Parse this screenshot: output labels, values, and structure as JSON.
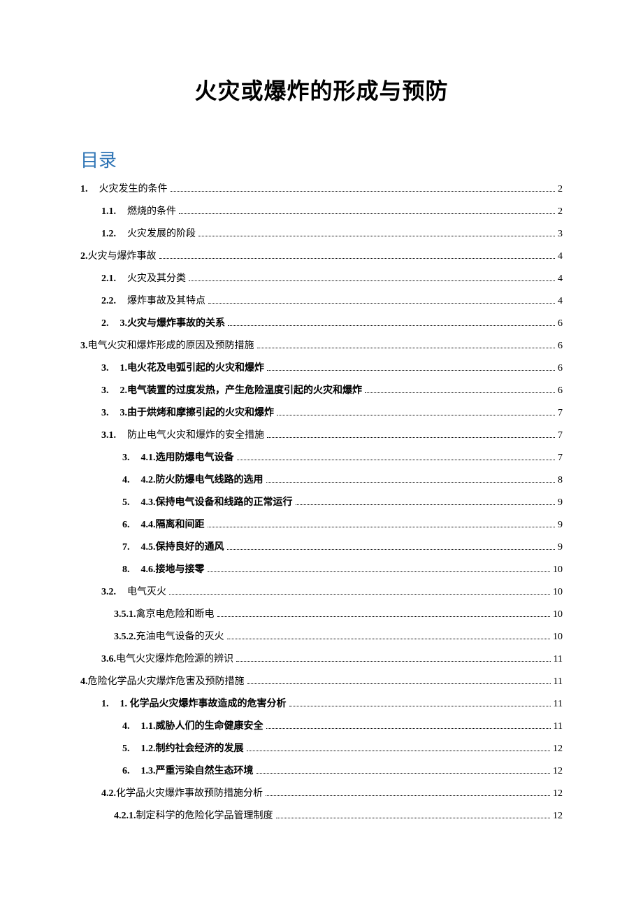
{
  "title": "火灾或爆炸的形成与预防",
  "toc_header": "目录",
  "toc": [
    {
      "indent": "ind-0",
      "num": "1.",
      "numBold": true,
      "text": "火灾发生的条件",
      "textBold": false,
      "page": "2"
    },
    {
      "indent": "ind-1",
      "num": "1.1.",
      "numBold": true,
      "text": "燃烧的条件",
      "textBold": false,
      "page": "2"
    },
    {
      "indent": "ind-1",
      "num": "1.2.",
      "numBold": true,
      "text": "火灾发展的阶段",
      "textBold": false,
      "page": "3"
    },
    {
      "indent": "ind-0",
      "num": "2.",
      "numBold": true,
      "text": "火灾与爆炸事故",
      "textBold": false,
      "page": "4",
      "joined": true
    },
    {
      "indent": "ind-1",
      "num": "2.1.",
      "numBold": true,
      "text": "火灾及其分类",
      "textBold": false,
      "page": "4"
    },
    {
      "indent": "ind-1",
      "num": "2.2.",
      "numBold": true,
      "text": "爆炸事故及其特点",
      "textBold": false,
      "page": "4"
    },
    {
      "indent": "ind-1",
      "num": "2.",
      "numBold": true,
      "text": "3.火灾与爆炸事故的关系",
      "textBold": true,
      "page": "6"
    },
    {
      "indent": "ind-0",
      "num": "3.",
      "numBold": true,
      "text": "电气火灾和爆炸形成的原因及预防措施",
      "textBold": false,
      "page": "6",
      "joined": true
    },
    {
      "indent": "ind-1",
      "num": "3.",
      "numBold": true,
      "text": "1.电火花及电弧引起的火灾和爆炸",
      "textBold": true,
      "page": "6"
    },
    {
      "indent": "ind-1",
      "num": "3.",
      "numBold": true,
      "text": "2.电气装置的过度发热，产生危险温度引起的火灾和爆炸",
      "textBold": true,
      "page": "6"
    },
    {
      "indent": "ind-1",
      "num": "3.",
      "numBold": true,
      "text": "3.由于烘烤和摩擦引起的火灾和爆炸",
      "textBold": true,
      "page": "7"
    },
    {
      "indent": "ind-1",
      "num": "3.1.",
      "numBold": true,
      "text": "防止电气火灾和爆炸的安全措施",
      "textBold": false,
      "page": "7"
    },
    {
      "indent": "ind-2",
      "num": "3.",
      "numBold": true,
      "text": "4.1.选用防爆电气设备",
      "textBold": true,
      "page": "7"
    },
    {
      "indent": "ind-2",
      "num": "4.",
      "numBold": true,
      "text": "4.2.防火防爆电气线路的选用",
      "textBold": true,
      "page": "8"
    },
    {
      "indent": "ind-2",
      "num": "5.",
      "numBold": true,
      "text": "4.3.保持电气设备和线路的正常运行",
      "textBold": true,
      "page": "9"
    },
    {
      "indent": "ind-2",
      "num": "6.",
      "numBold": true,
      "text": "4.4.隔离和间距",
      "textBold": true,
      "page": "9"
    },
    {
      "indent": "ind-2",
      "num": "7.",
      "numBold": true,
      "text": "4.5.保持良好的通风",
      "textBold": true,
      "page": "9"
    },
    {
      "indent": "ind-2",
      "num": "8.",
      "numBold": true,
      "text": "4.6.接地与接零",
      "textBold": true,
      "page": "10"
    },
    {
      "indent": "ind-1",
      "num": "3.2.",
      "numBold": true,
      "text": "电气灭火",
      "textBold": false,
      "page": "10"
    },
    {
      "indent": "ind-2b",
      "num": "3.5.1.",
      "numBold": true,
      "text": "禽京电危险和断电",
      "textBold": false,
      "page": "10",
      "joined": true
    },
    {
      "indent": "ind-2b",
      "num": "3.5.2.",
      "numBold": true,
      "text": "充油电气设备的灭火",
      "textBold": false,
      "page": "10",
      "joined": true
    },
    {
      "indent": "ind-1",
      "num": "3.6.",
      "numBold": true,
      "text": "电气火灾爆炸危险源的辨识",
      "textBold": false,
      "page": "11",
      "joined": true
    },
    {
      "indent": "ind-0",
      "num": "4.",
      "numBold": true,
      "text": "危险化学品火灾爆炸危害及预防措施",
      "textBold": false,
      "page": "11",
      "joined": true
    },
    {
      "indent": "ind-1",
      "num": "1.",
      "numBold": true,
      "text": "1. 化学品火灾爆炸事故造成的危害分析",
      "textBold": true,
      "page": "11"
    },
    {
      "indent": "ind-2",
      "num": "4.",
      "numBold": true,
      "text": "1.1.威胁人们的生命健康安全",
      "textBold": true,
      "page": "11"
    },
    {
      "indent": "ind-2",
      "num": "5.",
      "numBold": true,
      "text": "1.2.制约社会经济的发展",
      "textBold": true,
      "page": "12"
    },
    {
      "indent": "ind-2",
      "num": "6.",
      "numBold": true,
      "text": "1.3.严重污染自然生态环境",
      "textBold": true,
      "page": "12"
    },
    {
      "indent": "ind-1",
      "num": "4.2.",
      "numBold": true,
      "text": "化学品火灾爆炸事故预防措施分析",
      "textBold": false,
      "page": "12",
      "joined": true
    },
    {
      "indent": "ind-2b",
      "num": "4.2.1.",
      "numBold": true,
      "text": "制定科学的危险化学品管理制度",
      "textBold": false,
      "page": "12",
      "joined": true
    }
  ]
}
